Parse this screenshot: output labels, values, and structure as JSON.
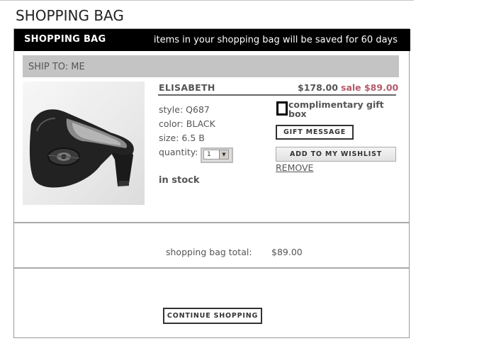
{
  "page": {
    "title": "SHOPPING BAG"
  },
  "bag": {
    "header_title": "SHOPPING BAG",
    "header_notice": "items in your shopping bag will be saved for 60 days",
    "ship_to": "SHIP TO:  ME"
  },
  "item": {
    "name": "ELISABETH",
    "price": "$178.00",
    "sale": "sale $89.00",
    "style": "style:  Q687",
    "color": "color:  BLACK",
    "size": "size:  6.5 B",
    "quantity_label": "quantity:",
    "quantity_value": "1",
    "stock": "in stock",
    "image_icon": "black-pump-shoe-image",
    "gift_box_label": "complimentary gift box",
    "gift_message_button": "GIFT MESSAGE",
    "wishlist_button": "ADD TO MY WISHLIST",
    "remove_link": "REMOVE"
  },
  "summary": {
    "total_label": "shopping bag total:",
    "total_value": "$89.00",
    "continue_button": "CONTINUE SHOPPING"
  },
  "colors": {
    "header_bg": "#000000",
    "ship_to_bg": "#c4c4c4",
    "sale_color": "#b55a6a"
  }
}
